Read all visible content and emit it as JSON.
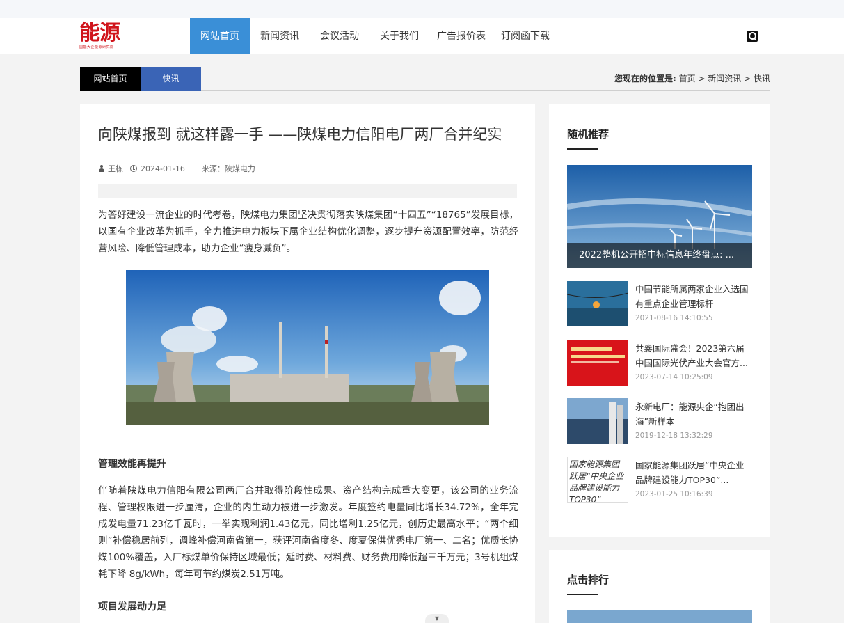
{
  "logo": {
    "text": "能源",
    "sub": "国能大企能源研究院"
  },
  "nav": {
    "items": [
      "网站首页",
      "新闻资讯",
      "会议活动",
      "关于我们",
      "广告报价表",
      "订阅函下载"
    ]
  },
  "breadcrumb": {
    "tab_home": "网站首页",
    "tab_current": "快讯",
    "location_label": "您现在的位置是:",
    "path": " 首页 > 新闻资讯 > 快讯"
  },
  "article": {
    "title": "向陕煤报到 就这样露一手 ——陕煤电力信阳电厂两厂合并纪实",
    "author": "王栋",
    "date": "2024-01-16",
    "source": "来源：陕煤电力",
    "para1": "为答好建设一流企业的时代考卷，陕煤电力集团坚决贯彻落实陕煤集团“十四五”“18765”发展目标，以国有企业改革为抓手，全力推进电力板块下属企业结构优化调整，逐步提升资源配置效率，防范经营风险、降低管理成本，助力企业“瘦身减负”。",
    "heading1": "管理效能再提升",
    "para2": "伴随着陕煤电力信阳有限公司两厂合并取得阶段性成果、资产结构完成重大变更，该公司的业务流程、管理权限进一步厘清，企业的内生动力被进一步激发。年度签约电量同比增长34.72%，全年完成发电量71.23亿千瓦时，一举实现利润1.43亿元，同比增利1.25亿元，创历史最高水平；“两个细则”补偿稳居前列，调峰补偿河南省第一，获评河南省度冬、度夏保供优秀电厂第一、二名；优质长协煤100%覆盖，入厂标煤单价保持区域最低；延时费、材料费、财务费用降低超三千万元；3号机组煤耗下降 8g/kWh，每年可节约煤炭2.51万吨。",
    "heading2": "项目发展动力足"
  },
  "sidebar": {
    "random_title": "随机推荐",
    "featured_caption": "2022整机公开招中标信息年终盘点: ...",
    "items": [
      {
        "title": "中国节能所属两家企业入选国有重点企业管理标杆",
        "date": "2021-08-16 14:10:55"
      },
      {
        "title": "共襄国际盛会！2023第六届中国国际光伏产业大会官方...",
        "date": "2023-07-14 10:25:09"
      },
      {
        "title": "永新电厂：能源央企“抱团出海”新样本",
        "date": "2019-12-18 13:32:29"
      },
      {
        "title": "国家能源集团跃居“中央企业品牌建设能力TOP30”...",
        "date": "2023-01-25 10:16:39",
        "alt": "国家能源集团跃居“中央企业品牌建设能力TOP30”"
      }
    ],
    "rank_title": "点击排行"
  }
}
